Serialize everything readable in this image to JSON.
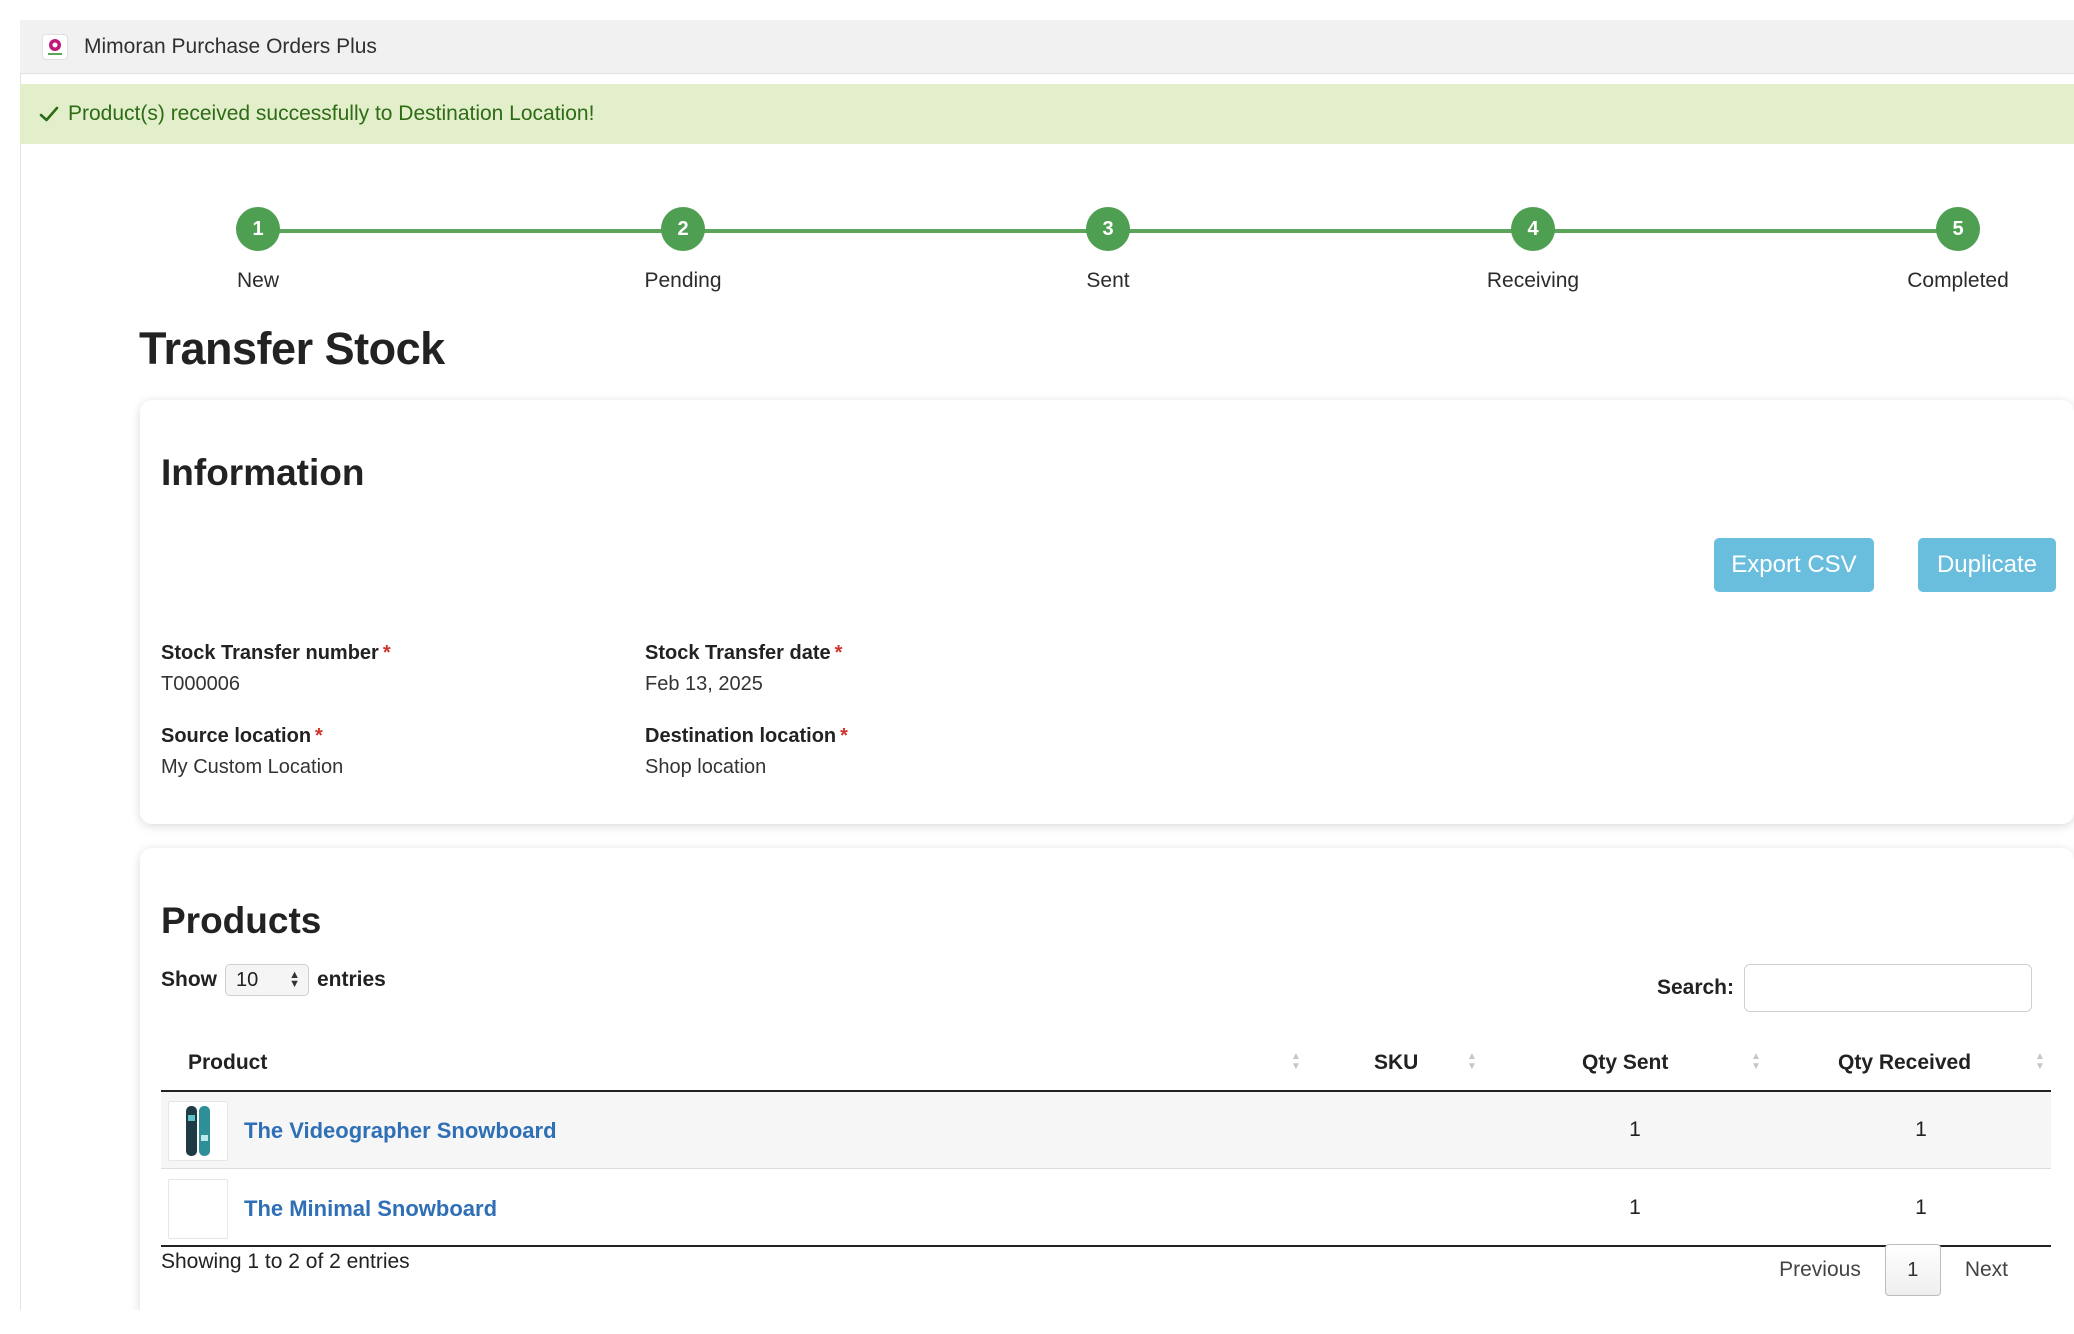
{
  "app": {
    "title": "Mimoran Purchase Orders Plus"
  },
  "banner": {
    "message": "Product(s) received successfully to Destination Location!"
  },
  "stepper": {
    "steps": [
      {
        "number": "1",
        "label": "New"
      },
      {
        "number": "2",
        "label": "Pending"
      },
      {
        "number": "3",
        "label": "Sent"
      },
      {
        "number": "4",
        "label": "Receiving"
      },
      {
        "number": "5",
        "label": "Completed"
      }
    ],
    "active_color": "#4f9f52"
  },
  "page": {
    "title": "Transfer Stock"
  },
  "information": {
    "title": "Information",
    "export_csv_label": "Export CSV",
    "duplicate_label": "Duplicate",
    "required_marker": "*",
    "fields": {
      "transfer_number": {
        "label": "Stock Transfer number",
        "value": "T000006"
      },
      "transfer_date": {
        "label": "Stock Transfer date",
        "value": "Feb 13, 2025"
      },
      "source_location": {
        "label": "Source location",
        "value": "My Custom Location"
      },
      "destination_location": {
        "label": "Destination location",
        "value": "Shop location"
      }
    }
  },
  "products": {
    "title": "Products",
    "show_label": "Show",
    "entries_value": "10",
    "entries_label": "entries",
    "search_label": "Search:",
    "search_value": "",
    "columns": {
      "product": "Product",
      "sku": "SKU",
      "qty_sent": "Qty Sent",
      "qty_received": "Qty Received"
    },
    "rows": [
      {
        "name": "The Videographer Snowboard",
        "sku": "",
        "qty_sent": "1",
        "qty_received": "1",
        "thumbnail": "snowboard-image"
      },
      {
        "name": "The Minimal Snowboard",
        "sku": "",
        "qty_sent": "1",
        "qty_received": "1",
        "thumbnail": ""
      }
    ],
    "summary": "Showing 1 to 2 of 2 entries",
    "pager": {
      "previous": "Previous",
      "current": "1",
      "next": "Next"
    }
  },
  "colors": {
    "banner_bg": "#e2efca",
    "banner_text": "#2e6b16",
    "button_bg": "#69bede",
    "link": "#2f6fb6",
    "step_green": "#4f9f52"
  }
}
